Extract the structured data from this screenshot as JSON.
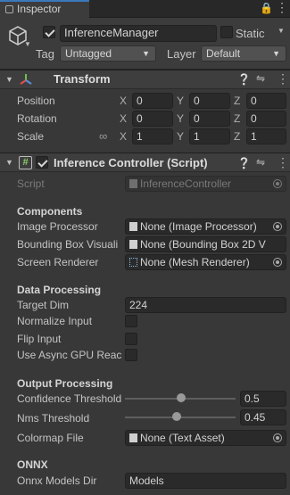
{
  "tab": {
    "title": "Inspector"
  },
  "header": {
    "object_name": "InferenceManager",
    "static_label": "Static",
    "tag_label": "Tag",
    "tag_value": "Untagged",
    "layer_label": "Layer",
    "layer_value": "Default"
  },
  "transform": {
    "title": "Transform",
    "position": {
      "label": "Position",
      "x": "0",
      "y": "0",
      "z": "0"
    },
    "rotation": {
      "label": "Rotation",
      "x": "0",
      "y": "0",
      "z": "0"
    },
    "scale": {
      "label": "Scale",
      "x": "1",
      "y": "1",
      "z": "1"
    },
    "axis": {
      "x": "X",
      "y": "Y",
      "z": "Z"
    }
  },
  "controller": {
    "title": "Inference Controller (Script)",
    "script_label": "Script",
    "script_value": "InferenceController",
    "components_header": "Components",
    "image_processor_label": "Image Processor",
    "image_processor_value": "None (Image Processor)",
    "bbox_label": "Bounding Box Visuali",
    "bbox_value": "None (Bounding Box 2D V",
    "screen_renderer_label": "Screen Renderer",
    "screen_renderer_value": "None (Mesh Renderer)",
    "data_header": "Data Processing",
    "target_dim_label": "Target Dim",
    "target_dim_value": "224",
    "normalize_label": "Normalize Input",
    "normalize_checked": false,
    "flip_label": "Flip Input",
    "flip_checked": false,
    "async_label": "Use Async GPU Reac",
    "async_checked": false,
    "output_header": "Output Processing",
    "confidence_label": "Confidence Threshold",
    "confidence_value": "0.5",
    "nms_label": "Nms Threshold",
    "nms_value": "0.45",
    "colormap_label": "Colormap File",
    "colormap_value": "None (Text Asset)",
    "onnx_header": "ONNX",
    "onnx_dir_label": "Onnx Models Dir",
    "onnx_dir_value": "Models"
  },
  "colors": {
    "accent": "#3a79bb",
    "background": "#383838",
    "field": "#2a2a2a"
  },
  "icons": [
    "gameobject-cube-icon",
    "lock-icon",
    "menu-icon",
    "help-icon",
    "presets-icon",
    "more-icon",
    "transform-axes-icon",
    "script-hash-icon",
    "link-icon",
    "object-picker-icon"
  ]
}
